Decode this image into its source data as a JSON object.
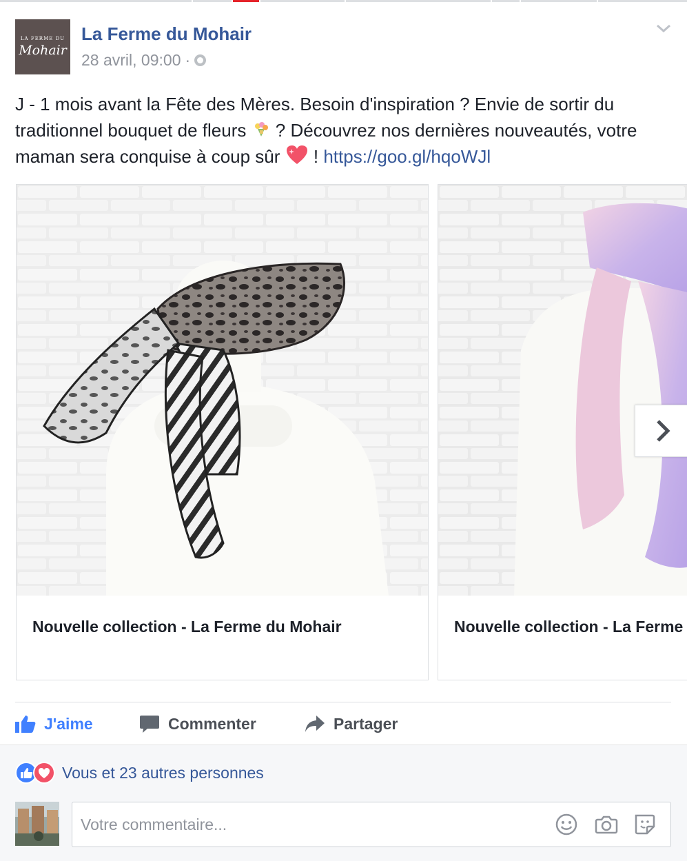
{
  "post": {
    "page_name": "La Ferme du Mohair",
    "avatar_text_small": "LA FERME DU",
    "avatar_text_big": "Mohair",
    "timestamp": "28 avril, 09:00",
    "separator": "·",
    "privacy_icon": "globe-icon",
    "text_part1": "J - 1 mois avant la Fête des Mères. Besoin d'inspiration ? Envie de sortir du traditionnel bouquet de fleurs ",
    "text_part2": " ? Découvrez nos dernières nouveautés, votre maman sera conquise à coup sûr ",
    "text_part3": " ! ",
    "link": "https://goo.gl/hqoWJl"
  },
  "carousel": {
    "cards": [
      {
        "caption": "Nouvelle collection - La Ferme du Mohair"
      },
      {
        "caption": "Nouvelle collection - La Ferme du Mohair"
      }
    ],
    "next_icon": "chevron-right-icon"
  },
  "actions": {
    "like": "J'aime",
    "comment": "Commenter",
    "share": "Partager"
  },
  "reactions": {
    "summary": "Vous et 23 autres personnes",
    "types": [
      "like",
      "love"
    ]
  },
  "comment_box": {
    "placeholder": "Votre commentaire..."
  },
  "colors": {
    "link": "#365899",
    "like_active": "#4080ff",
    "love": "#f25268"
  }
}
